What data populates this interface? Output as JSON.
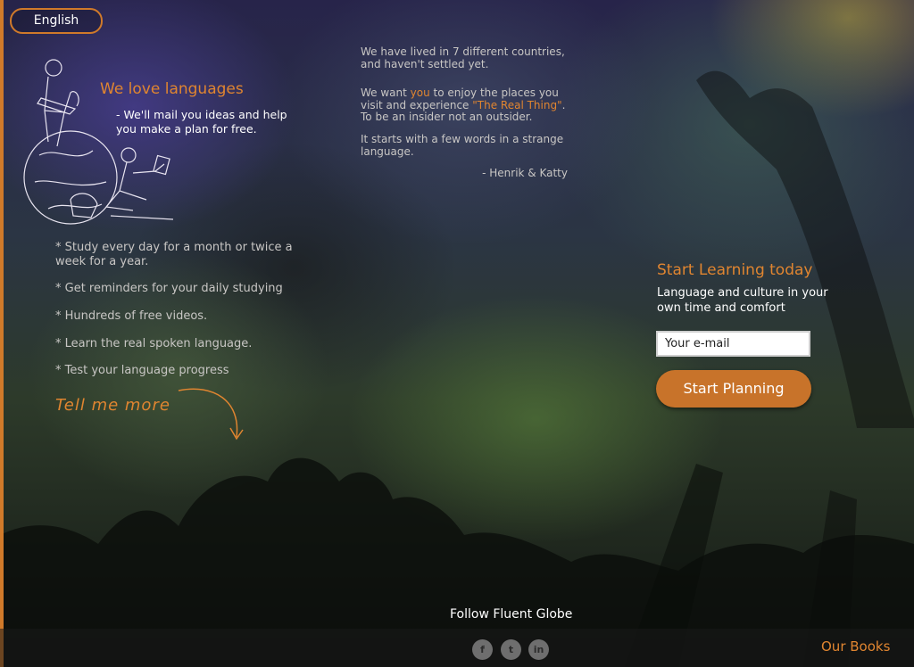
{
  "language_button": "English",
  "intro": {
    "heading": "We love languages",
    "text": "- We'll mail you ideas and help you make a plan for free."
  },
  "features": [
    "* Study every day for a month or twice a week for a year.",
    "* Get reminders for your daily studying",
    "* Hundreds of free videos.",
    "* Learn the real spoken language.",
    "* Test your language progress"
  ],
  "tell_more": "Tell me more",
  "quote": {
    "p1": "We have lived in 7 different countries, and haven't settled yet.",
    "p2_a": "We want ",
    "p2_hl": "you",
    "p2_b": " to enjoy the places you visit and experience ",
    "p2_hl2": "\"The Real Thing\"",
    "p2_c": ". To be an insider not an outsider.",
    "p3": "It starts with a few words in a strange language.",
    "signature": "- Henrik & Katty"
  },
  "signup": {
    "heading": "Start Learning today",
    "subtitle": "Language and culture in your own time and comfort",
    "email_placeholder": "Your e-mail",
    "button": "Start Planning"
  },
  "footer": {
    "follow": "Follow Fluent Globe",
    "social": [
      {
        "icon": "facebook-icon",
        "glyph": "f"
      },
      {
        "icon": "twitter-icon",
        "glyph": "t"
      },
      {
        "icon": "linkedin-icon",
        "glyph": "in"
      }
    ],
    "books": "Our Books"
  },
  "colors": {
    "accent": "#e08530",
    "button": "#c8732a"
  }
}
